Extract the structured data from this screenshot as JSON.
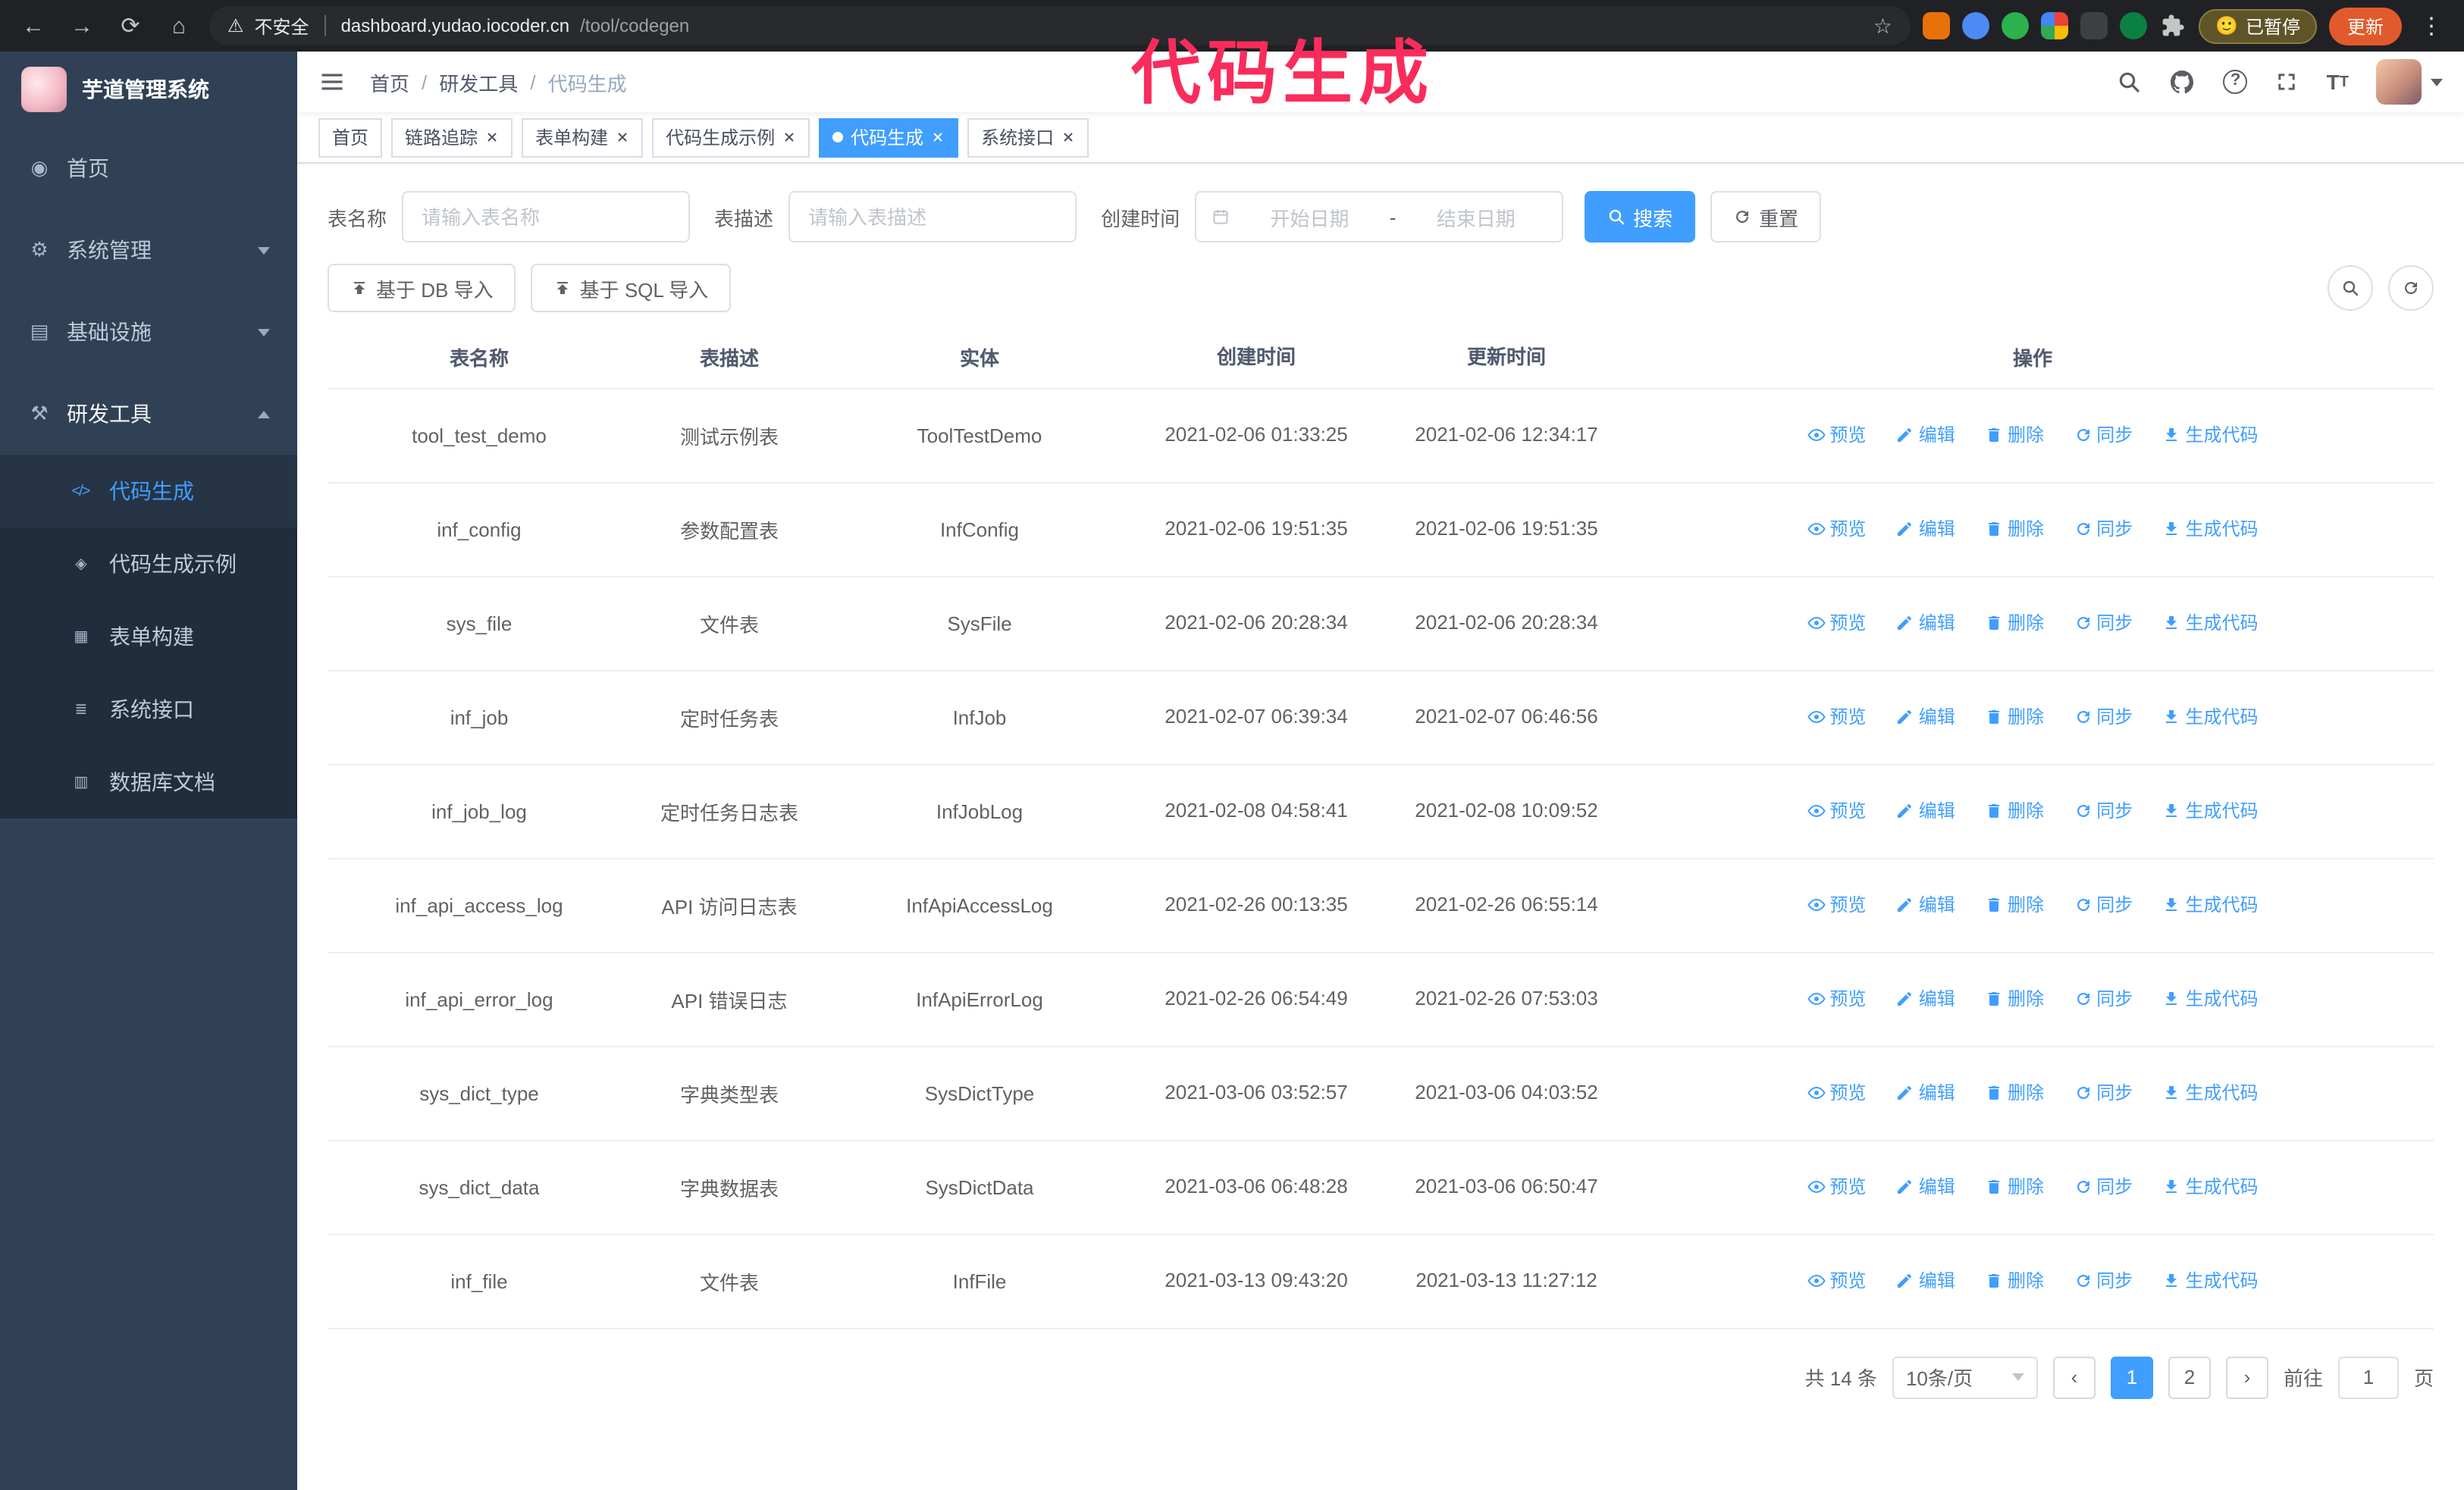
{
  "annotation": {
    "text": "代码生成",
    "color": "#fa2c5c"
  },
  "glyphs": {
    "back": "←",
    "forward": "→",
    "reload": "⟳",
    "home": "⌂",
    "warning": "⚠",
    "star": "☆",
    "kebab": "⋮",
    "prev": "‹",
    "next": "›",
    "slash": "/",
    "question": "?",
    "font_large": "T",
    "font_small": "T"
  },
  "browser": {
    "security_warning": "不安全",
    "url_domain": "dashboard.yudao.iocoder.cn",
    "url_path": "/tool/codegen",
    "pause_emoji": "🙂",
    "paused_badge": "已暂停",
    "update_button": "更新"
  },
  "sidebar": {
    "logo_title": "芋道管理系统",
    "items": [
      {
        "icon": "◉",
        "label": "首页"
      },
      {
        "icon": "⚙",
        "label": "系统管理"
      },
      {
        "icon": "▤",
        "label": "基础设施"
      },
      {
        "icon": "⚒",
        "label": "研发工具"
      }
    ],
    "sub_items": [
      {
        "icon": "</>",
        "label": "代码生成"
      },
      {
        "icon": "◈",
        "label": "代码生成示例"
      },
      {
        "icon": "▦",
        "label": "表单构建"
      },
      {
        "icon": "≣",
        "label": "系统接口"
      },
      {
        "icon": "▥",
        "label": "数据库文档"
      }
    ]
  },
  "header": {
    "breadcrumb": [
      "首页",
      "研发工具",
      "代码生成"
    ]
  },
  "tabs": [
    {
      "label": "首页"
    },
    {
      "label": "链路追踪"
    },
    {
      "label": "表单构建"
    },
    {
      "label": "代码生成示例"
    },
    {
      "label": "代码生成"
    },
    {
      "label": "系统接口"
    }
  ],
  "filter": {
    "table_name_label": "表名称",
    "table_name_placeholder": "请输入表名称",
    "table_desc_label": "表描述",
    "table_desc_placeholder": "请输入表描述",
    "create_time_label": "创建时间",
    "date_start_placeholder": "开始日期",
    "date_separator": "-",
    "date_end_placeholder": "结束日期",
    "search_button": "搜索",
    "reset_button": "重置"
  },
  "toolbar": {
    "import_db_label": "基于 DB 导入",
    "import_sql_label": "基于 SQL 导入"
  },
  "table": {
    "columns": [
      "表名称",
      "表描述",
      "实体",
      "创建时间",
      "更新时间",
      "操作"
    ],
    "actions": [
      "预览",
      "编辑",
      "删除",
      "同步",
      "生成代码"
    ],
    "rows": [
      {
        "name": "tool_test_demo",
        "desc": "测试示例表",
        "entity": "ToolTestDemo",
        "created": "2021-02-06 01:33:25",
        "updated": "2021-02-06 12:34:17"
      },
      {
        "name": "inf_config",
        "desc": "参数配置表",
        "entity": "InfConfig",
        "created": "2021-02-06 19:51:35",
        "updated": "2021-02-06 19:51:35"
      },
      {
        "name": "sys_file",
        "desc": "文件表",
        "entity": "SysFile",
        "created": "2021-02-06 20:28:34",
        "updated": "2021-02-06 20:28:34"
      },
      {
        "name": "inf_job",
        "desc": "定时任务表",
        "entity": "InfJob",
        "created": "2021-02-07 06:39:34",
        "updated": "2021-02-07 06:46:56"
      },
      {
        "name": "inf_job_log",
        "desc": "定时任务日志表",
        "entity": "InfJobLog",
        "created": "2021-02-08 04:58:41",
        "updated": "2021-02-08 10:09:52"
      },
      {
        "name": "inf_api_access_log",
        "desc": "API 访问日志表",
        "entity": "InfApiAccessLog",
        "created": "2021-02-26 00:13:35",
        "updated": "2021-02-26 06:55:14"
      },
      {
        "name": "inf_api_error_log",
        "desc": "API 错误日志",
        "entity": "InfApiErrorLog",
        "created": "2021-02-26 06:54:49",
        "updated": "2021-02-26 07:53:03"
      },
      {
        "name": "sys_dict_type",
        "desc": "字典类型表",
        "entity": "SysDictType",
        "created": "2021-03-06 03:52:57",
        "updated": "2021-03-06 04:03:52"
      },
      {
        "name": "sys_dict_data",
        "desc": "字典数据表",
        "entity": "SysDictData",
        "created": "2021-03-06 06:48:28",
        "updated": "2021-03-06 06:50:47"
      },
      {
        "name": "inf_file",
        "desc": "文件表",
        "entity": "InfFile",
        "created": "2021-03-13 09:43:20",
        "updated": "2021-03-13 11:27:12"
      }
    ]
  },
  "pagination": {
    "total": "共 14 条",
    "page_size": "10条/页",
    "pages": [
      "1",
      "2"
    ],
    "goto_label": "前往",
    "goto_value": "1",
    "goto_unit": "页"
  }
}
